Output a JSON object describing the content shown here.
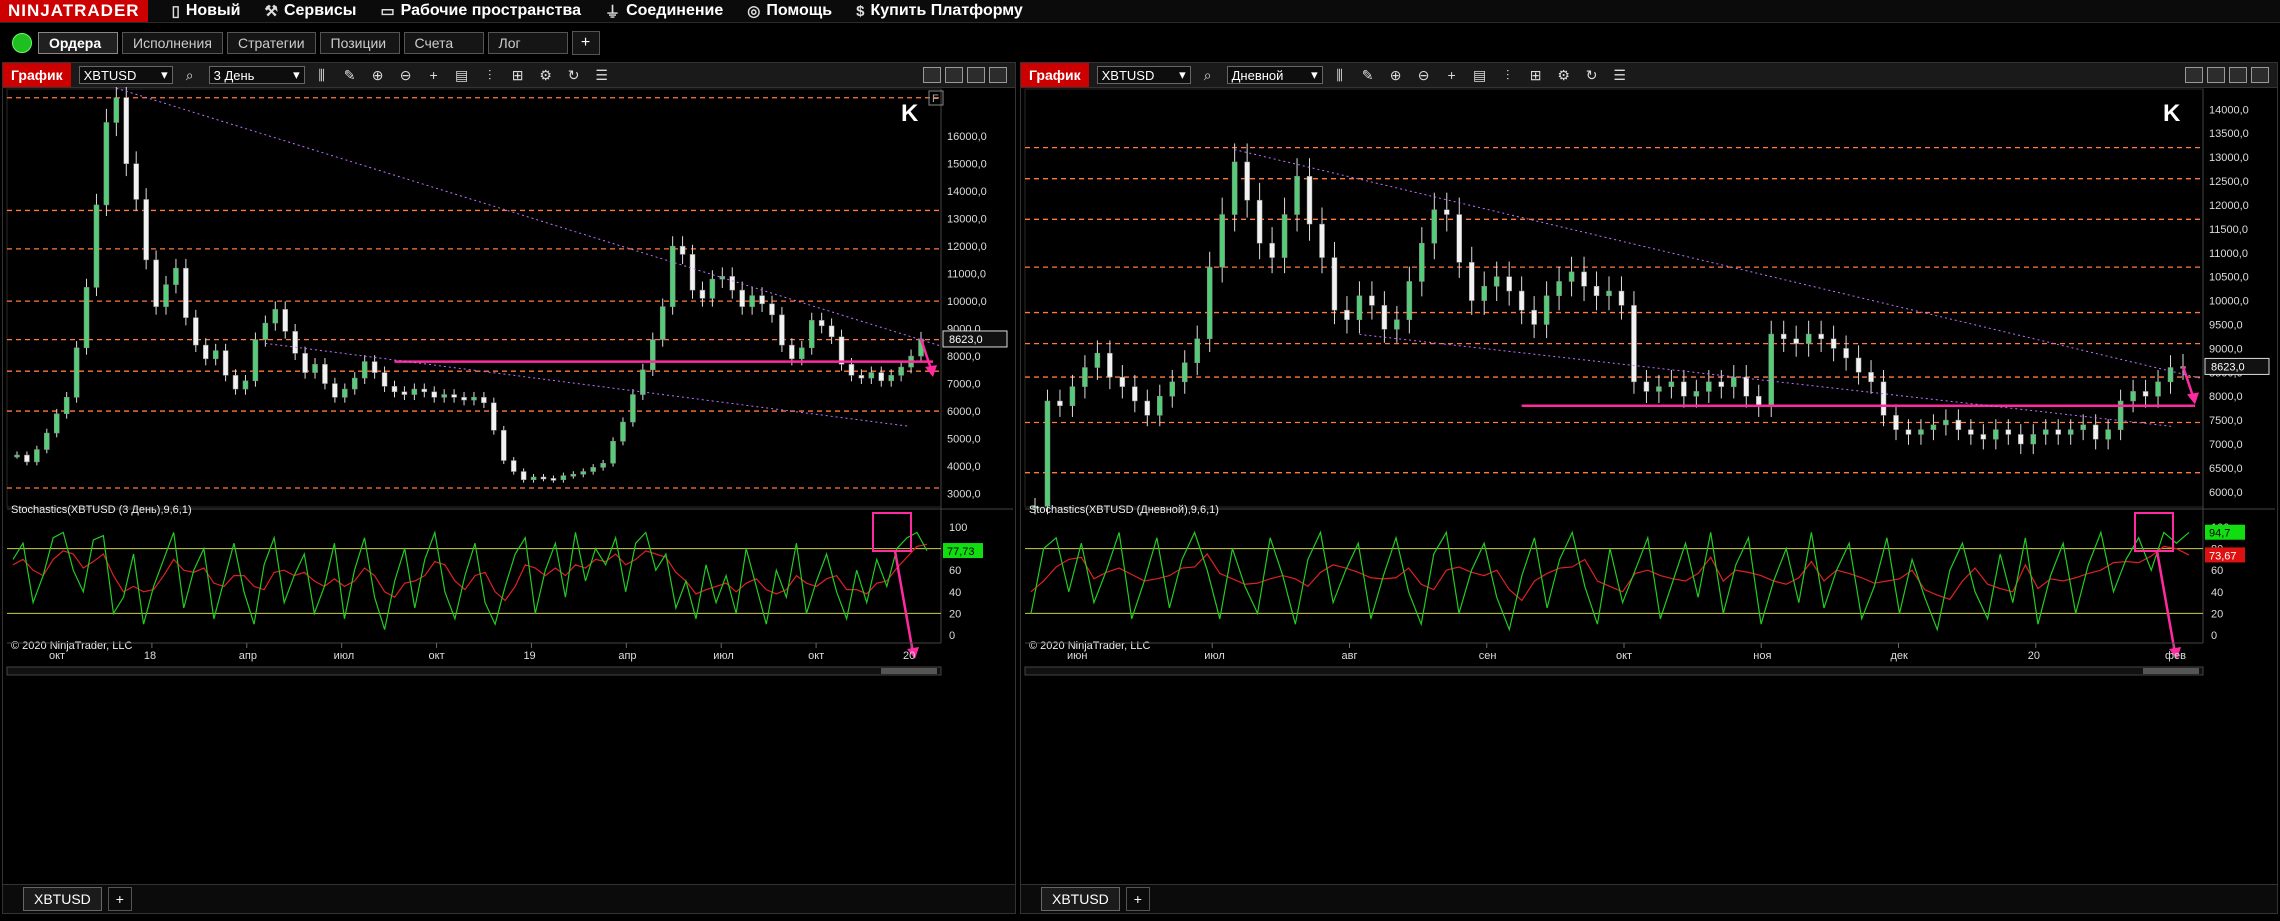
{
  "app": {
    "brand": "NINJATRADER"
  },
  "menu": [
    {
      "label": "Новый",
      "icon": "new-document-icon"
    },
    {
      "label": "Сервисы",
      "icon": "tools-icon"
    },
    {
      "label": "Рабочие пространства",
      "icon": "workspace-icon"
    },
    {
      "label": "Соединение",
      "icon": "connection-plug-icon"
    },
    {
      "label": "Помощь",
      "icon": "help-lifebuoy-icon"
    },
    {
      "label": "Купить Платформу",
      "icon": "dollar-icon"
    }
  ],
  "tabs": [
    "Ордера",
    "Исполнения",
    "Стратегии",
    "Позиции",
    "Счета",
    "Лог"
  ],
  "colors": {
    "accent": "#cc0000",
    "price_up": "#55cc77",
    "stoch_k": "#22cc22",
    "stoch_d": "#dd2222",
    "trend": "#ff2aa0",
    "level": "#ff7a3d"
  },
  "panels": [
    {
      "title": "График",
      "instrument": "XBTUSD",
      "period": "3 День",
      "indicator_label": "Stochastics(XBTUSD (3 День),9,6,1)",
      "copyright": "© 2020 NinjaTrader, LLC",
      "bottom_tab": "XBTUSD",
      "f_label": "F",
      "chart_data": {
        "type": "candlestick",
        "x_labels": [
          "окт",
          "18",
          "апр",
          "июл",
          "окт",
          "19",
          "апр",
          "июл",
          "окт",
          "20"
        ],
        "y_labels": [
          "16000,0",
          "15000,0",
          "14000,0",
          "13000,0",
          "12000,0",
          "11000,0",
          "10000,0",
          "9000,0",
          "8000,0",
          "7000,0",
          "6000,0",
          "5000,0",
          "4000,0",
          "3000,0"
        ],
        "ylim": [
          2800,
          17500
        ],
        "last_price": "8623,0",
        "horizontal_levels": [
          3200,
          6000,
          7450,
          8600,
          10000,
          11900,
          13300,
          17400
        ],
        "support_line": 7800,
        "stoch_labels": [
          "100",
          "80",
          "60",
          "40",
          "20",
          "0"
        ],
        "stoch_levels": [
          80,
          20
        ],
        "stoch_value_k": "77,73",
        "stoch_value_d": "",
        "closes": [
          4400,
          4150,
          4600,
          5200,
          5900,
          6500,
          8300,
          10500,
          13500,
          16500,
          17400,
          15000,
          13700,
          11500,
          9800,
          10600,
          11200,
          9400,
          8400,
          7900,
          8200,
          7300,
          6800,
          7100,
          8600,
          9200,
          9700,
          8900,
          8100,
          7400,
          7700,
          7000,
          6500,
          6800,
          7200,
          7800,
          7400,
          6900,
          6700,
          6600,
          6800,
          6700,
          6500,
          6600,
          6500,
          6400,
          6500,
          6300,
          5300,
          4200,
          3800,
          3500,
          3600,
          3550,
          3500,
          3650,
          3700,
          3800,
          3950,
          4100,
          4900,
          5600,
          6600,
          7500,
          8600,
          9800,
          12000,
          11700,
          10400,
          10100,
          10800,
          10900,
          10400,
          9800,
          10200,
          9900,
          9500,
          8400,
          7900,
          8300,
          9300,
          9100,
          8700,
          7700,
          7300,
          7200,
          7400,
          7100,
          7300,
          7600,
          8000,
          8623
        ],
        "stoch_k": [
          70,
          85,
          30,
          55,
          90,
          95,
          60,
          40,
          88,
          92,
          20,
          35,
          75,
          10,
          45,
          70,
          95,
          25,
          60,
          80,
          15,
          50,
          85,
          40,
          10,
          65,
          90,
          30,
          55,
          75,
          20,
          45,
          85,
          15,
          60,
          90,
          35,
          5,
          50,
          80,
          25,
          70,
          95,
          40,
          15,
          55,
          85,
          30,
          10,
          45,
          75,
          90,
          20,
          60,
          85,
          35,
          95,
          50,
          80,
          65,
          90,
          40,
          85,
          95,
          60,
          75,
          25,
          50,
          15,
          65,
          30,
          55,
          20,
          80,
          45,
          10,
          60,
          35,
          85,
          20,
          50,
          75,
          40,
          15,
          60,
          30,
          70,
          45,
          80,
          90,
          95,
          78
        ],
        "stoch_d": [
          65,
          70,
          60,
          55,
          70,
          78,
          75,
          62,
          68,
          75,
          55,
          40,
          45,
          40,
          42,
          55,
          70,
          60,
          58,
          62,
          48,
          45,
          55,
          55,
          45,
          42,
          58,
          60,
          55,
          58,
          50,
          45,
          52,
          45,
          50,
          62,
          55,
          40,
          35,
          48,
          50,
          55,
          68,
          65,
          50,
          42,
          55,
          58,
          40,
          32,
          45,
          65,
          62,
          55,
          62,
          55,
          65,
          62,
          70,
          68,
          75,
          65,
          70,
          78,
          75,
          72,
          58,
          50,
          38,
          42,
          45,
          48,
          40,
          48,
          52,
          42,
          38,
          42,
          55,
          48,
          45,
          52,
          55,
          42,
          42,
          38,
          48,
          50,
          62,
          72,
          82,
          84
        ]
      }
    },
    {
      "title": "График",
      "instrument": "XBTUSD",
      "period": "Дневной",
      "indicator_label": "Stochastics(XBTUSD (Дневной),9,6,1)",
      "copyright": "© 2020 NinjaTrader, LLC",
      "bottom_tab": "XBTUSD",
      "f_label": "",
      "chart_data": {
        "type": "candlestick",
        "x_labels": [
          "июн",
          "июл",
          "авг",
          "сен",
          "окт",
          "ноя",
          "дек",
          "20",
          "фев"
        ],
        "y_labels": [
          "14000,0",
          "13500,0",
          "13000,0",
          "12500,0",
          "12000,0",
          "11500,0",
          "11000,0",
          "10500,0",
          "10000,0",
          "9500,0",
          "9000,0",
          "8500,0",
          "8000,0",
          "7500,0",
          "7000,0",
          "6500,0",
          "6000,0"
        ],
        "ylim": [
          5850,
          14300
        ],
        "last_price": "8623,0",
        "horizontal_levels": [
          6400,
          7450,
          8400,
          9100,
          9750,
          10700,
          11700,
          12550,
          13200
        ],
        "support_line": 7800,
        "stoch_labels": [
          "100",
          "80",
          "60",
          "40",
          "20",
          "0"
        ],
        "stoch_levels": [
          80,
          20
        ],
        "stoch_value_k": "94,7",
        "stoch_value_d": "73,67",
        "closes": [
          5700,
          7900,
          7800,
          8200,
          8600,
          8900,
          8400,
          8200,
          7900,
          7600,
          8000,
          8300,
          8700,
          9200,
          10700,
          11800,
          12900,
          12100,
          11200,
          10900,
          11800,
          12600,
          11600,
          10900,
          9800,
          9600,
          10100,
          9900,
          9400,
          9600,
          10400,
          11200,
          11900,
          11800,
          10800,
          10000,
          10300,
          10500,
          10200,
          9800,
          9500,
          10100,
          10400,
          10600,
          10300,
          10100,
          10200,
          9900,
          8300,
          8100,
          8200,
          8300,
          8000,
          8100,
          8300,
          8200,
          8400,
          8000,
          7800,
          9300,
          9200,
          9100,
          9300,
          9200,
          9000,
          8800,
          8500,
          8300,
          7600,
          7300,
          7200,
          7300,
          7400,
          7500,
          7300,
          7200,
          7100,
          7300,
          7200,
          7000,
          7200,
          7300,
          7200,
          7300,
          7400,
          7100,
          7300,
          7900,
          8100,
          8000,
          8300,
          8600,
          8623
        ],
        "stoch_k": [
          20,
          80,
          90,
          40,
          85,
          30,
          60,
          95,
          15,
          50,
          90,
          25,
          70,
          95,
          60,
          15,
          80,
          45,
          20,
          90,
          55,
          10,
          70,
          95,
          30,
          60,
          85,
          15,
          55,
          90,
          40,
          10,
          75,
          95,
          20,
          60,
          85,
          35,
          5,
          55,
          90,
          25,
          70,
          95,
          45,
          10,
          80,
          30,
          60,
          90,
          15,
          50,
          85,
          35,
          95,
          20,
          65,
          90,
          10,
          50,
          80,
          30,
          95,
          25,
          60,
          85,
          15,
          45,
          90,
          20,
          70,
          35,
          5,
          60,
          85,
          40,
          15,
          75,
          30,
          90,
          10,
          55,
          85,
          20,
          65,
          95,
          40,
          70,
          90,
          60,
          95,
          85,
          95
        ],
        "stoch_d": [
          40,
          50,
          63,
          70,
          72,
          52,
          58,
          62,
          56,
          50,
          52,
          55,
          62,
          63,
          75,
          57,
          52,
          47,
          48,
          52,
          55,
          52,
          45,
          58,
          65,
          62,
          58,
          53,
          52,
          53,
          62,
          47,
          42,
          60,
          63,
          58,
          55,
          60,
          42,
          32,
          50,
          57,
          62,
          63,
          70,
          50,
          45,
          40,
          57,
          60,
          55,
          52,
          50,
          57,
          72,
          50,
          60,
          58,
          55,
          50,
          47,
          53,
          68,
          50,
          60,
          57,
          53,
          48,
          50,
          52,
          60,
          42,
          37,
          33,
          50,
          62,
          47,
          43,
          40,
          65,
          43,
          52,
          50,
          53,
          57,
          60,
          67,
          68,
          67,
          73,
          82,
          80,
          74
        ]
      }
    }
  ]
}
